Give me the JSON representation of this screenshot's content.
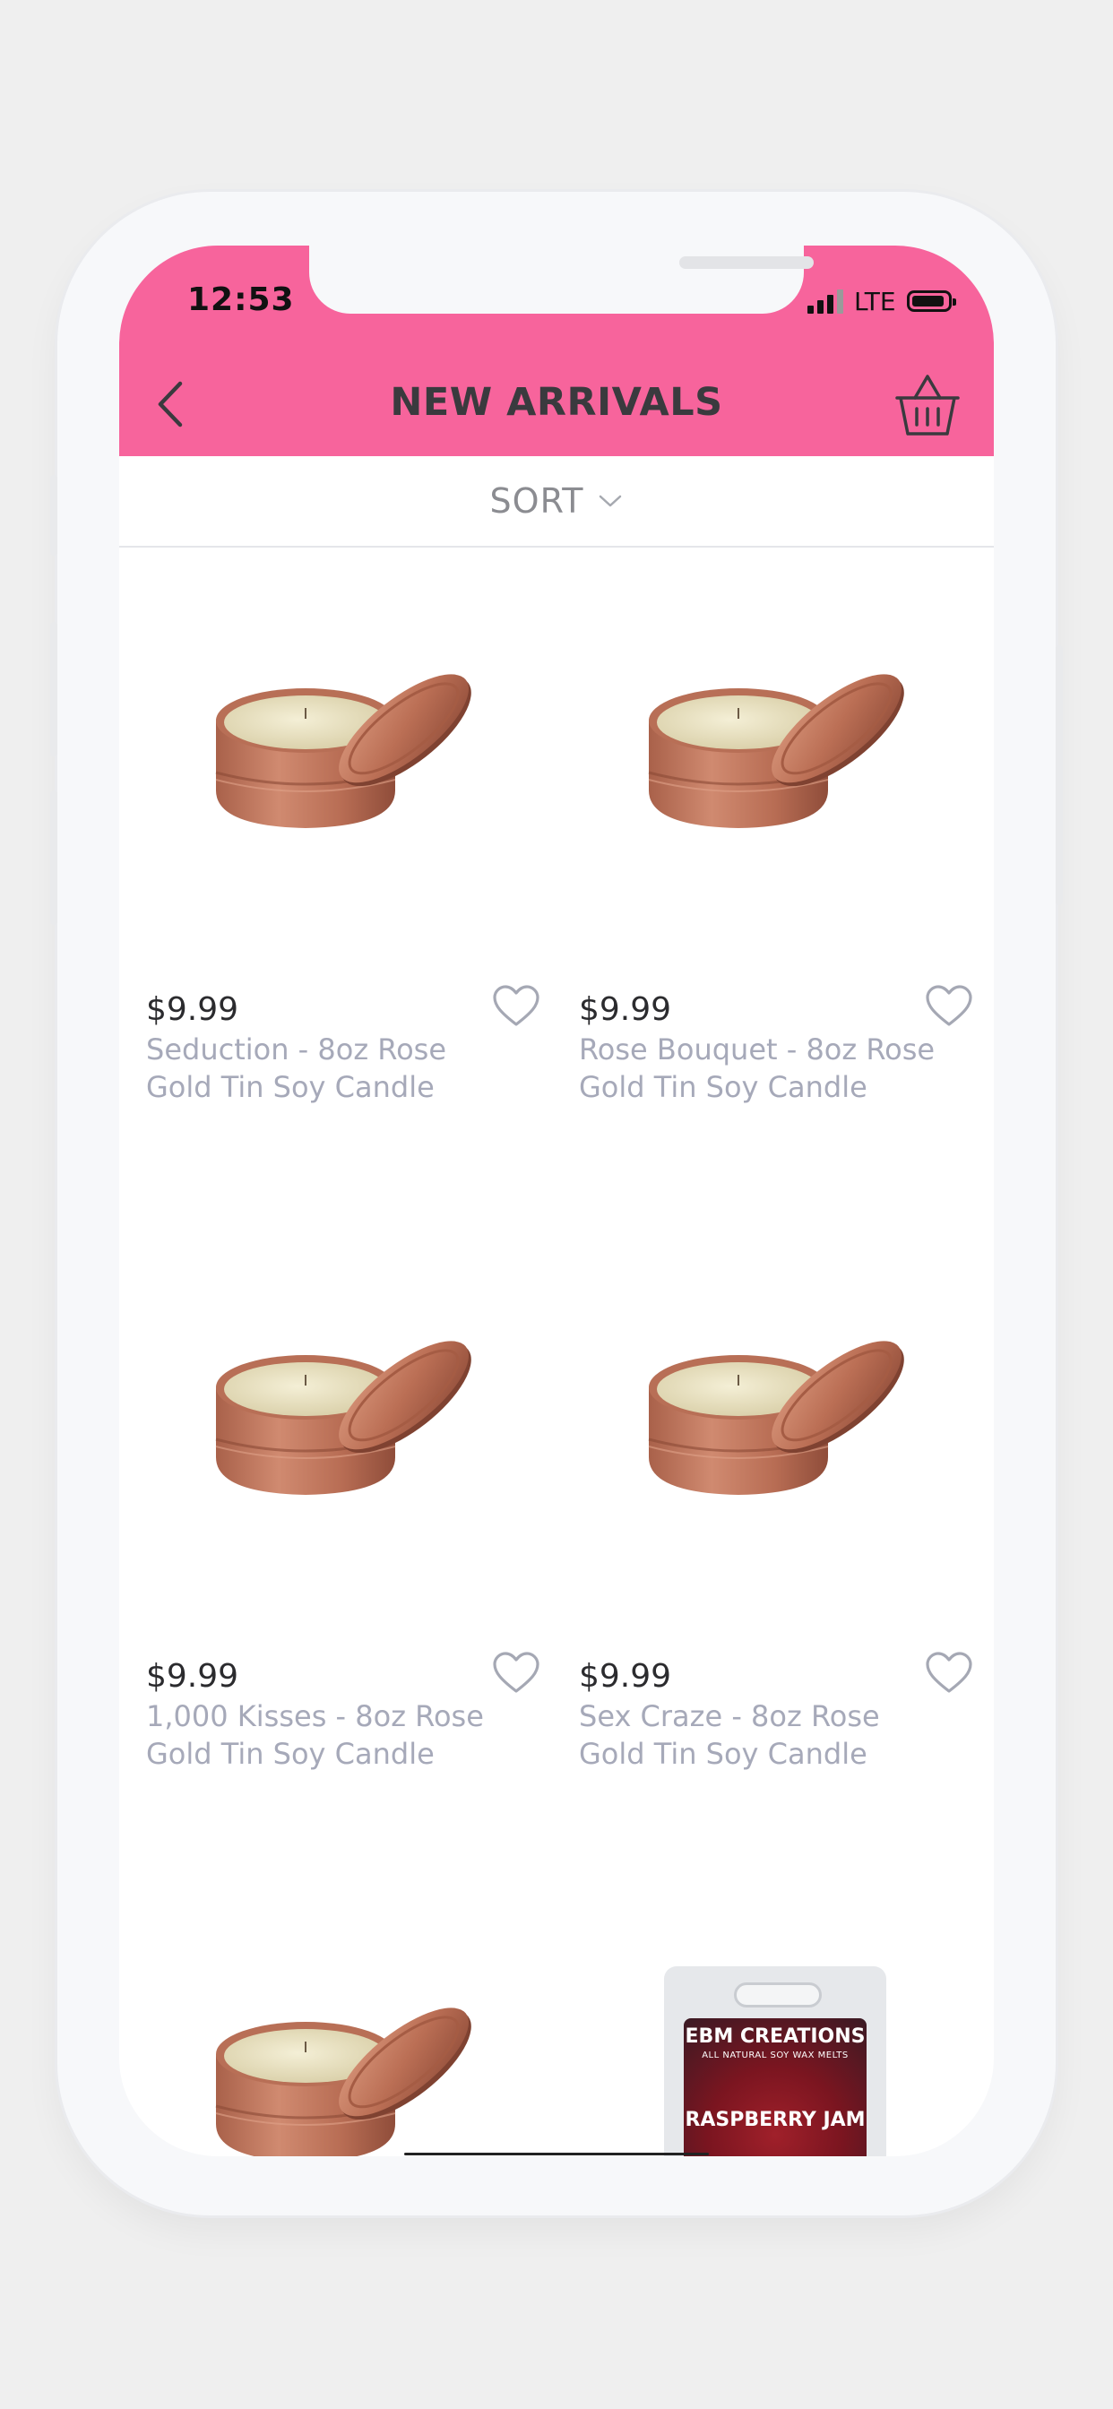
{
  "status_bar": {
    "time": "12:53",
    "network": "LTE"
  },
  "header": {
    "title": "NEW ARRIVALS",
    "back_icon": "chevron-left-icon",
    "cart_icon": "basket-icon"
  },
  "sort": {
    "label": "SORT",
    "icon": "chevron-down-icon"
  },
  "colors": {
    "header_bg": "#f7649c",
    "name_text": "#a6a9b9",
    "price_text": "#2b2b2e"
  },
  "products": [
    {
      "price": "$9.99",
      "name": "Seduction - 8oz Rose Gold Tin Soy Candle"
    },
    {
      "price": "$9.99",
      "name": "Rose Bouquet - 8oz Rose Gold Tin Soy Candle"
    },
    {
      "price": "$9.99",
      "name": "1,000 Kisses - 8oz Rose Gold Tin Soy Candle"
    },
    {
      "price": "$9.99",
      "name": "Sex Craze - 8oz Rose Gold Tin Soy Candle"
    }
  ],
  "partial_products": {
    "wax_melt": {
      "brand": "EBM CREATIONS",
      "subtitle": "ALL NATURAL SOY WAX MELTS",
      "scent": "RASPBERRY JAM"
    }
  }
}
